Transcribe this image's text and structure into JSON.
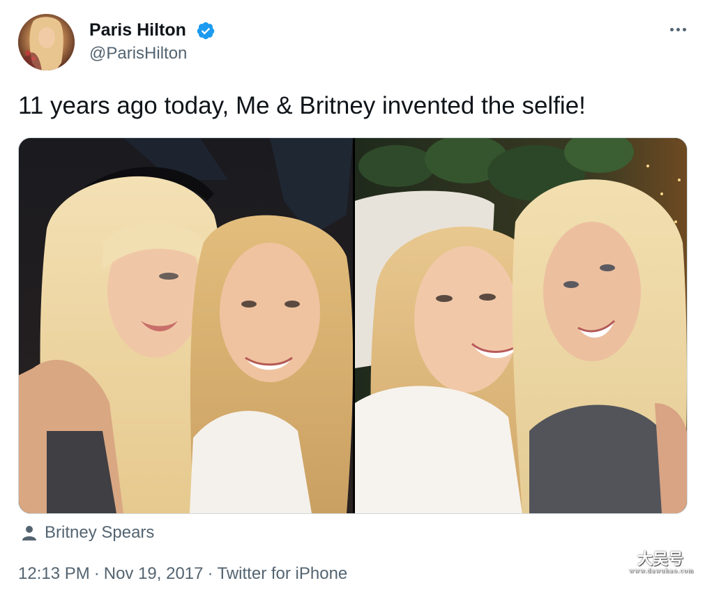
{
  "author": {
    "name": "Paris Hilton",
    "handle": "@ParisHilton",
    "verified": true,
    "verified_color": "#1d9bf0"
  },
  "tweet": {
    "text": "11 years ago today, Me & Britney invented the selfie!"
  },
  "media": {
    "photos": [
      {
        "name": "selfie-photo-left"
      },
      {
        "name": "selfie-photo-right"
      }
    ]
  },
  "tagged": {
    "icon": "person-icon",
    "label": "Britney Spears"
  },
  "meta": {
    "time": "12:13 PM",
    "date": "Nov 19, 2017",
    "source": "Twitter for iPhone",
    "separator": "·"
  },
  "more_icon": "more-icon",
  "watermark": {
    "text": "大吴号",
    "subtext": "www.dawuhao.com"
  },
  "colors": {
    "text_primary": "#0f1419",
    "text_secondary": "#536471",
    "border": "#cfd9de"
  }
}
